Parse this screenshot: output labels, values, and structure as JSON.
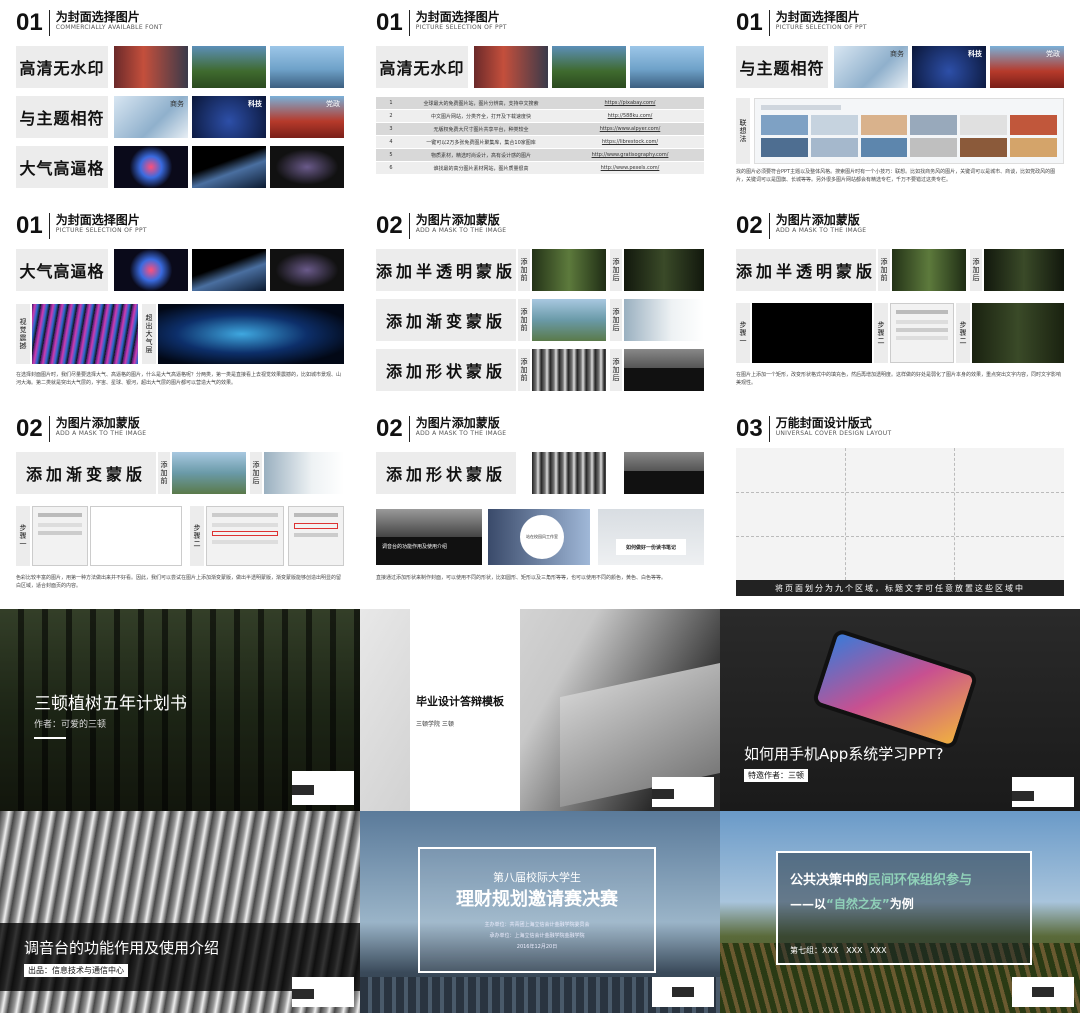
{
  "slides": {
    "s1": {
      "num": "01",
      "title": "为封面选择图片",
      "subtitle": "COMMERCIALLY AVAILABLE FONT",
      "rows": [
        "高清无水印",
        "与主题相符",
        "大气高逼格"
      ],
      "tags": {
        "business": "商务",
        "tech": "科技",
        "party": "党政"
      }
    },
    "s2": {
      "num": "01",
      "title": "为封面选择图片",
      "subtitle": "PICTURE SELECTION OF PPT",
      "label": "高清无水印",
      "table": [
        [
          "1",
          "全球最大的免费图片站，图片分辨高，支持中文搜索",
          "https://pixabay.com/"
        ],
        [
          "2",
          "中文图片网站，分类齐全，打开及下载速度快",
          "http://588ku.com/"
        ],
        [
          "3",
          "无版权免费大尺寸图片共享平台，种类较全",
          "https://www.alpyer.com/"
        ],
        [
          "4",
          "一键可以2万多张免费图片聚集库，集合10家图库",
          "https://librestock.com/"
        ],
        [
          "5",
          "物质素材，精选时尚设计，高有设计感的图片",
          "http://www.gratisography.com/"
        ],
        [
          "6",
          "谁找最的高分图片素材网站，图片质量很高",
          "http://www.pexels.com/"
        ]
      ]
    },
    "s3": {
      "num": "01",
      "title": "为封面选择图片",
      "subtitle": "PICTURE SELECTION OF PPT",
      "label": "与主题相符",
      "tags": {
        "business": "商务",
        "tech": "科技",
        "party": "党政"
      },
      "side": "联想法",
      "desc": "找的图片必须要符合PPT主题以及整体风格。搜索图片时有一个小技巧：联想。比如找商务风的图片，关键词可以是城市、商谈，比如党政风的图片，关键词可以是国旗、长城等等。另外很多图片网站都会有精选专栏，千万不要错过这类专栏。"
    },
    "s4": {
      "num": "01",
      "title": "为封面选择图片",
      "subtitle": "PICTURE SELECTION OF PPT",
      "label": "大气高逼格",
      "side1": "视觉震撼",
      "side2": "超出大气层",
      "desc": "在选择封面图片时，我们尽量要选择大气、高逼格的图片，什么是大气高逼格呢？分两类，第一类是直接看上去视觉效果震撼的，比如城市景观、山河大海。第二类就是突出大气层的，宇宙、星球、银河，超出大气层的图片都可以营造大气的效果。"
    },
    "s5": {
      "num": "02",
      "title": "为图片添加蒙版",
      "subtitle": "ADD A MASK TO THE IMAGE",
      "rows": [
        "添加半透明蒙版",
        "添加渐变蒙版",
        "添加形状蒙版"
      ],
      "before": "添加前",
      "after": "添加后"
    },
    "s6": {
      "num": "02",
      "title": "为图片添加蒙版",
      "subtitle": "ADD A MASK TO THE IMAGE",
      "label": "添加半透明蒙版",
      "before": "添加前",
      "after": "添加后",
      "step1": "步骤一",
      "step2": "步骤二",
      "desc": "在图片上添加一个矩形，改变形状格式中的填充色，然后再增加透明度。这样做的好处是弱化了图片本身的效果，重点突出文字内容，同时文字影响美观性。"
    },
    "s7": {
      "num": "02",
      "title": "为图片添加蒙版",
      "subtitle": "ADD A MASK TO THE IMAGE",
      "label": "添加渐变蒙版",
      "before": "添加前",
      "after": "添加后",
      "step1": "步骤一",
      "step2": "步骤二",
      "desc": "色彩比较丰富的图片，用第一种方法做出来并不好看。因此，我们可以尝试在图片上添加渐变蒙版，做出半透明蒙版，渐变蒙版能够创造出明显的留白区域，适合封面页的内容。"
    },
    "s8": {
      "num": "02",
      "title": "为图片添加蒙版",
      "subtitle": "ADD A MASK TO THE IMAGE",
      "label": "添加形状蒙版",
      "c1": "调音台的功能作用及使用介绍",
      "c2": "站在校园风工作室",
      "c3": "如何做好一份读书笔记",
      "desc": "直接通过添加形状来制作封面，可以使用不同的形状，比如圆形、矩形以及三角形等等，也可以使用不同的颜色，黄色、白色等等。"
    },
    "s9": {
      "num": "03",
      "title": "万能封面设计版式",
      "subtitle": "UNIVERSAL COVER DESIGN LAYOUT",
      "banner": "将页面划分为九个区域，标题文字可任意放置这些区域中"
    },
    "c1": {
      "title": "三顿植树五年计划书",
      "author": "作者：可爱的三顿"
    },
    "c2": {
      "title": "毕业设计答辩模板",
      "author": "三顿学院 三顿"
    },
    "c3": {
      "title": "如何用手机App系统学习PPT?",
      "author": "特邀作者：三顿"
    },
    "c4": {
      "title": "调音台的功能作用及使用介绍",
      "author": "出品：信息技术与通信中心"
    },
    "c5": {
      "line1": "第八届校际大学生",
      "line2": "理财规划邀请赛决赛",
      "org1": "主办单位：共青团上海立信会计金融学院委员会",
      "org2": "承办单位：上海立信会计金融学院金融学院",
      "date": "2016年12月20日"
    },
    "c6": {
      "title_a": "公共决策中的",
      "title_b": "民间环保组织参与",
      "sub_a": "——以",
      "sub_b": "“自然之友”",
      "sub_c": "为例",
      "group": "第七组：XXX   XXX   XXX"
    }
  },
  "colors": {
    "accent_green": "#8fd0b8",
    "dark": "#1b1b1b"
  }
}
